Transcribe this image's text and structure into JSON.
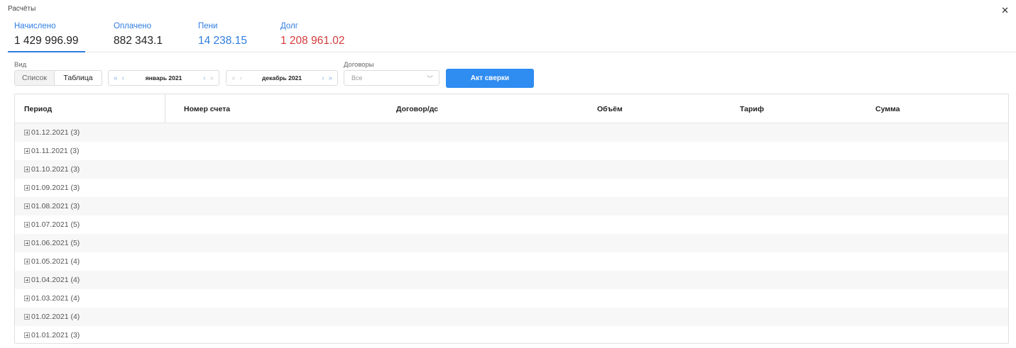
{
  "window": {
    "title": "Расчёты"
  },
  "summary": [
    {
      "label": "Начислено",
      "value": "1 429 996.99"
    },
    {
      "label": "Оплачено",
      "value": "882 343.1"
    },
    {
      "label": "Пени",
      "value": "14 238.15"
    },
    {
      "label": "Долг",
      "value": "1 208 961.02"
    }
  ],
  "filters": {
    "view_label": "Вид",
    "view_options": [
      "Список",
      "Таблица"
    ],
    "selected_view": "Таблица",
    "date_from": "январь 2021",
    "date_to": "декабрь 2021",
    "contracts_label": "Договоры",
    "contracts_value": "Все",
    "reconcile_button": "Акт сверки"
  },
  "table": {
    "columns": [
      "Период",
      "Номер счета",
      "Договор/дс",
      "Объём",
      "Тариф",
      "Сумма"
    ],
    "rows": [
      "01.12.2021 (3)",
      "01.11.2021 (3)",
      "01.10.2021 (3)",
      "01.09.2021 (3)",
      "01.08.2021 (3)",
      "01.07.2021 (5)",
      "01.06.2021 (5)",
      "01.05.2021 (4)",
      "01.04.2021 (4)",
      "01.03.2021 (4)",
      "01.02.2021 (4)",
      "01.01.2021 (3)"
    ]
  },
  "colors": {
    "accent": "#2f7de1",
    "debt": "#d33a3a",
    "button": "#2f8cf1"
  },
  "icons": {
    "close": "close-icon",
    "expand": "plus-box-icon"
  }
}
